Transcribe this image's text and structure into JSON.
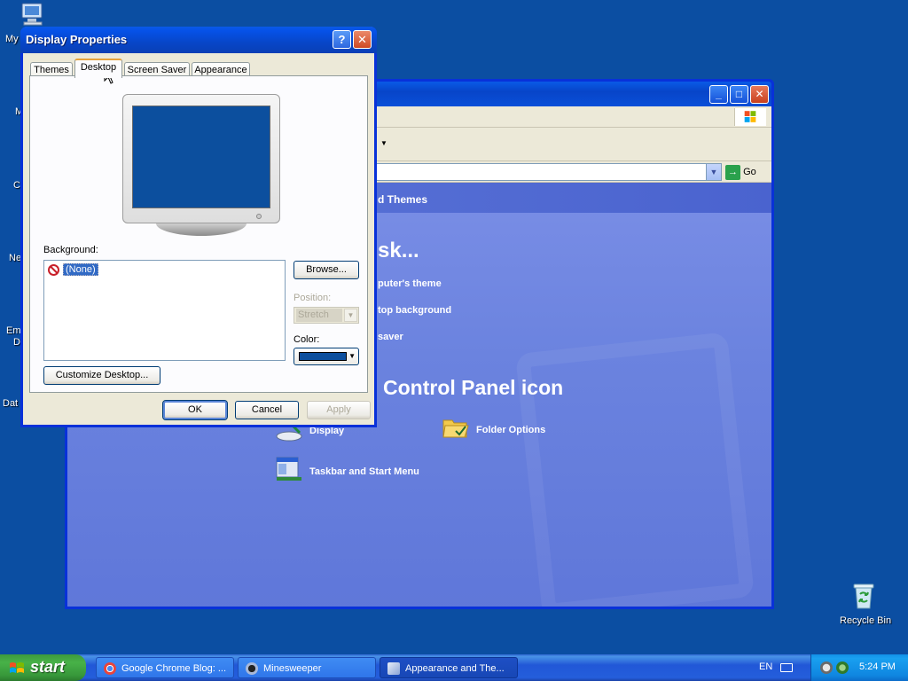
{
  "desktop": {
    "left_labels": [
      "My",
      "M",
      "C",
      "Ne",
      "Em",
      "D",
      "Dat"
    ],
    "recycle_bin": "Recycle Bin"
  },
  "control_panel": {
    "address_go": "Go",
    "header_partial": "d Themes",
    "task_heading_partial": "sk...",
    "tasks_partial": [
      "puter's theme",
      "top background",
      "saver"
    ],
    "icon_heading_partial": "Control Panel icon",
    "icons": [
      "Display",
      "Folder Options",
      "Taskbar and Start Menu"
    ],
    "window_buttons": {
      "minimize": "_",
      "maximize": "□",
      "close": "✕"
    }
  },
  "dialog": {
    "title": "Display Properties",
    "help_btn": "?",
    "close_btn": "✕",
    "tabs": [
      "Themes",
      "Desktop",
      "Screen Saver",
      "Appearance"
    ],
    "active_tab": "Desktop",
    "background_label": "Background:",
    "background_items": [
      "(None)"
    ],
    "browse": "Browse...",
    "position_label": "Position:",
    "position_value": "Stretch",
    "color_label": "Color:",
    "color_value": "#0c4f9e",
    "customize": "Customize Desktop...",
    "ok": "OK",
    "cancel": "Cancel",
    "apply": "Apply"
  },
  "taskbar": {
    "start": "start",
    "tasks": [
      {
        "label": "Google Chrome Blog: ...",
        "icon": "chrome-icon"
      },
      {
        "label": "Minesweeper",
        "icon": "minesweeper-icon"
      },
      {
        "label": "Appearance and The...",
        "icon": "control-panel-icon"
      }
    ],
    "language": "EN",
    "clock": "5:24 PM"
  },
  "colors": {
    "desktop": "#0b4ea2",
    "xp_blue": "#0831d9",
    "start_green": "#3c9a3c"
  }
}
